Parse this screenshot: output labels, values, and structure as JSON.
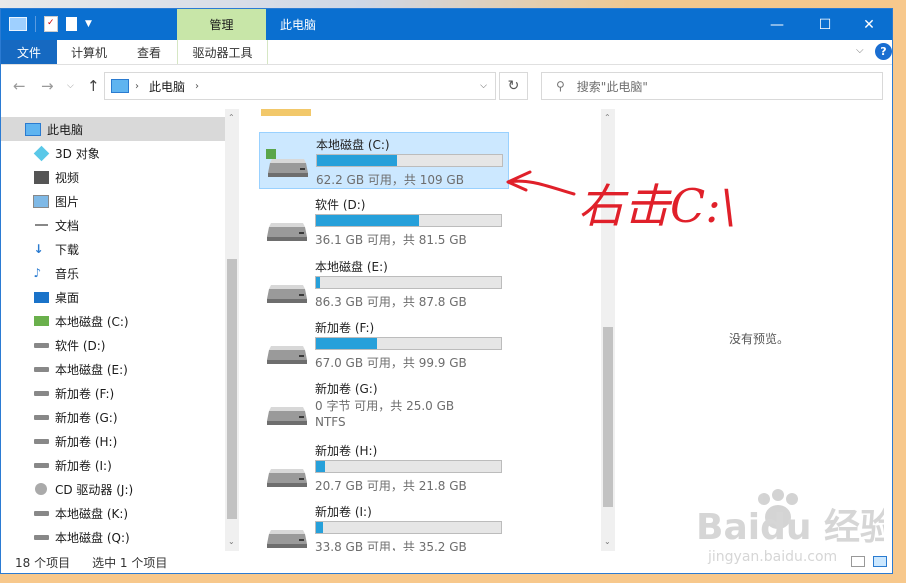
{
  "window": {
    "title": "此电脑",
    "context_tab": "管理",
    "ribbon_tabs": [
      "文件",
      "计算机",
      "查看",
      "驱动器工具"
    ]
  },
  "address": {
    "crumb": "此电脑",
    "search_placeholder": "搜索\"此电脑\""
  },
  "nav": {
    "items": [
      {
        "label": "此电脑",
        "icon": "pc-icon",
        "selected": true,
        "level": 0
      },
      {
        "label": "3D 对象",
        "icon": "3d-objects-icon",
        "level": 1
      },
      {
        "label": "视频",
        "icon": "video-icon",
        "level": 1
      },
      {
        "label": "图片",
        "icon": "pictures-icon",
        "level": 1
      },
      {
        "label": "文档",
        "icon": "documents-icon",
        "level": 1
      },
      {
        "label": "下载",
        "icon": "download-icon",
        "level": 1
      },
      {
        "label": "音乐",
        "icon": "music-icon",
        "level": 1
      },
      {
        "label": "桌面",
        "icon": "desktop-icon",
        "level": 1
      },
      {
        "label": "本地磁盘 (C:)",
        "icon": "system-drive-icon",
        "level": 1
      },
      {
        "label": "软件 (D:)",
        "icon": "drive-icon",
        "level": 1
      },
      {
        "label": "本地磁盘 (E:)",
        "icon": "drive-icon",
        "level": 1
      },
      {
        "label": "新加卷 (F:)",
        "icon": "drive-icon",
        "level": 1
      },
      {
        "label": "新加卷 (G:)",
        "icon": "drive-icon",
        "level": 1
      },
      {
        "label": "新加卷 (H:)",
        "icon": "drive-icon",
        "level": 1
      },
      {
        "label": "新加卷 (I:)",
        "icon": "drive-icon",
        "level": 1
      },
      {
        "label": "CD 驱动器 (J:)",
        "icon": "cd-drive-icon",
        "level": 1
      },
      {
        "label": "本地磁盘 (K:)",
        "icon": "drive-icon",
        "level": 1
      },
      {
        "label": "本地磁盘 (Q:)",
        "icon": "drive-icon",
        "level": 1
      }
    ]
  },
  "drives": [
    {
      "name": "本地磁盘 (C:)",
      "info": "62.2 GB 可用，共 109 GB",
      "used_fraction": 0.43,
      "system": true,
      "selected": true
    },
    {
      "name": "软件 (D:)",
      "info": "36.1 GB 可用，共 81.5 GB",
      "used_fraction": 0.557
    },
    {
      "name": "本地磁盘 (E:)",
      "info": "86.3 GB 可用，共 87.8 GB",
      "used_fraction": 0.017
    },
    {
      "name": "新加卷 (F:)",
      "info": "67.0 GB 可用，共 99.9 GB",
      "used_fraction": 0.329
    },
    {
      "name": "新加卷 (G:)",
      "info": "0 字节 可用，共 25.0 GB",
      "info2": "NTFS",
      "no_bar": true
    },
    {
      "name": "新加卷 (H:)",
      "info": "20.7 GB 可用，共 21.8 GB",
      "used_fraction": 0.05
    },
    {
      "name": "新加卷 (I:)",
      "info": "33.8 GB 可用，共 35.2 GB",
      "used_fraction": 0.04
    }
  ],
  "preview": {
    "text": "没有预览。"
  },
  "status": {
    "count": "18 个项目",
    "selected": "选中 1 个项目"
  },
  "annotation": {
    "text": "右击C:\\"
  },
  "watermark": {
    "brand": "Baidu 经验",
    "url": "jingyan.baidu.com"
  },
  "colors": {
    "accent": "#0a6fd0",
    "bar_fill": "#26a0da",
    "context_tab": "#c8e6a8",
    "annotation": "#e0202a"
  }
}
